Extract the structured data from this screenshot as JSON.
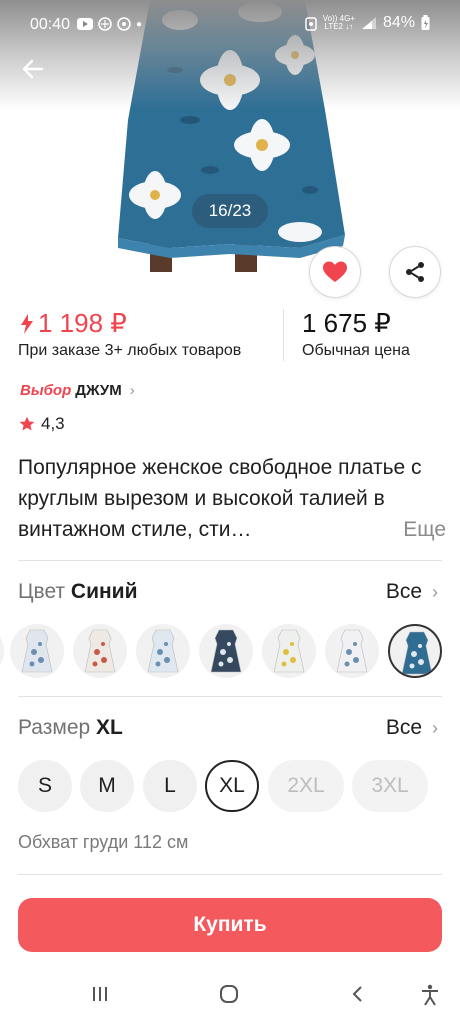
{
  "status_bar": {
    "time": "00:40",
    "battery": "84%",
    "network_top": "Vo)) 4G+",
    "network_bottom": "LTE2 ↓↑"
  },
  "gallery": {
    "counter": "16/23"
  },
  "price": {
    "sale": "1 198 ₽",
    "sale_note": "При заказе 3+ любых товаров",
    "regular": "1 675 ₽",
    "regular_note": "Обычная цена"
  },
  "brand": {
    "badge": "Выбор",
    "name": "ДЖУМ"
  },
  "rating": {
    "value": "4,3"
  },
  "product": {
    "title": "Популярное женское свободное платье с круглым вырезом и высокой талией в винтажном стиле, сти…",
    "more": "Еще"
  },
  "color_section": {
    "label": "Цвет",
    "value": "Синий",
    "all": "Все",
    "swatch_colors": [
      "#dfe6ee",
      "#efe9e4",
      "#dfe8f0",
      "#34495e",
      "#eef0ee",
      "#f1f1f3",
      "#2f6d93"
    ],
    "selected_index": 6
  },
  "size_section": {
    "label": "Размер",
    "value": "XL",
    "all": "Все",
    "sizes": [
      "S",
      "M",
      "L",
      "XL",
      "2XL",
      "3XL"
    ],
    "chest": "Обхват груди 112 см"
  },
  "actions": {
    "buy": "Купить"
  },
  "colors": {
    "accent": "#f0454f",
    "buy_button": "#f4595e"
  }
}
